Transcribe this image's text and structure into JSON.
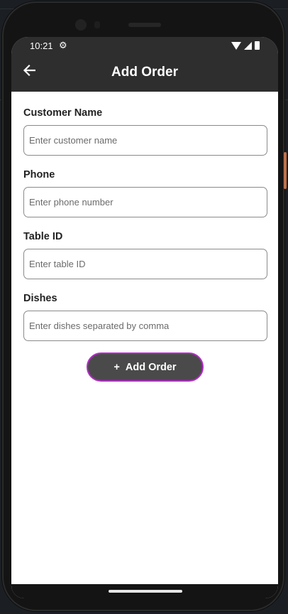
{
  "status_bar": {
    "time": "10:21",
    "settings_icon": "gear-icon",
    "wifi_icon": "wifi-icon",
    "signal_icon": "signal-icon",
    "battery_icon": "battery-icon"
  },
  "app_bar": {
    "title": "Add Order",
    "back_icon": "arrow-left-icon",
    "background": "#2e2e2e"
  },
  "form": {
    "customer_name": {
      "label": "Customer Name",
      "value": "",
      "placeholder": "Enter customer name"
    },
    "phone": {
      "label": "Phone",
      "value": "",
      "placeholder": "Enter phone number"
    },
    "table_id": {
      "label": "Table ID",
      "value": "",
      "placeholder": "Enter table ID"
    },
    "dishes": {
      "label": "Dishes",
      "value": "",
      "placeholder": "Enter dishes separated by comma"
    }
  },
  "add_button": {
    "icon": "+",
    "label": "Add Order",
    "background": "#4a4a4a",
    "border_color": "#b22cc6"
  }
}
